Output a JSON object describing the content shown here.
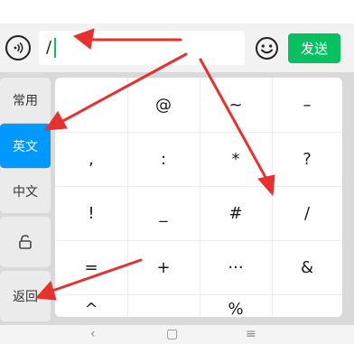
{
  "input_bar": {
    "text_value": "/",
    "send_label": "发送",
    "voice_icon": "voice-icon",
    "emoji_icon": "emoji-icon"
  },
  "sidebar": {
    "items": [
      {
        "label": "常用",
        "active": false
      },
      {
        "label": "英文",
        "active": true
      },
      {
        "label": "中文",
        "active": false
      }
    ],
    "lock_icon": "lock-icon",
    "back_label": "返回"
  },
  "keys": {
    "rows": [
      [
        "",
        "@",
        "~",
        "–"
      ],
      [
        ",",
        ":",
        "*",
        "?"
      ],
      [
        "!",
        "_",
        "#",
        "/"
      ],
      [
        "=",
        "+",
        "···",
        "&"
      ],
      [
        "^",
        "",
        "%",
        ""
      ]
    ]
  },
  "nav": {
    "back": "‹",
    "home": "▢",
    "menu": "≡"
  },
  "colors": {
    "accent_green": "#07c160",
    "active_blue": "#0099ff",
    "arrow_red": "#e8312f"
  }
}
